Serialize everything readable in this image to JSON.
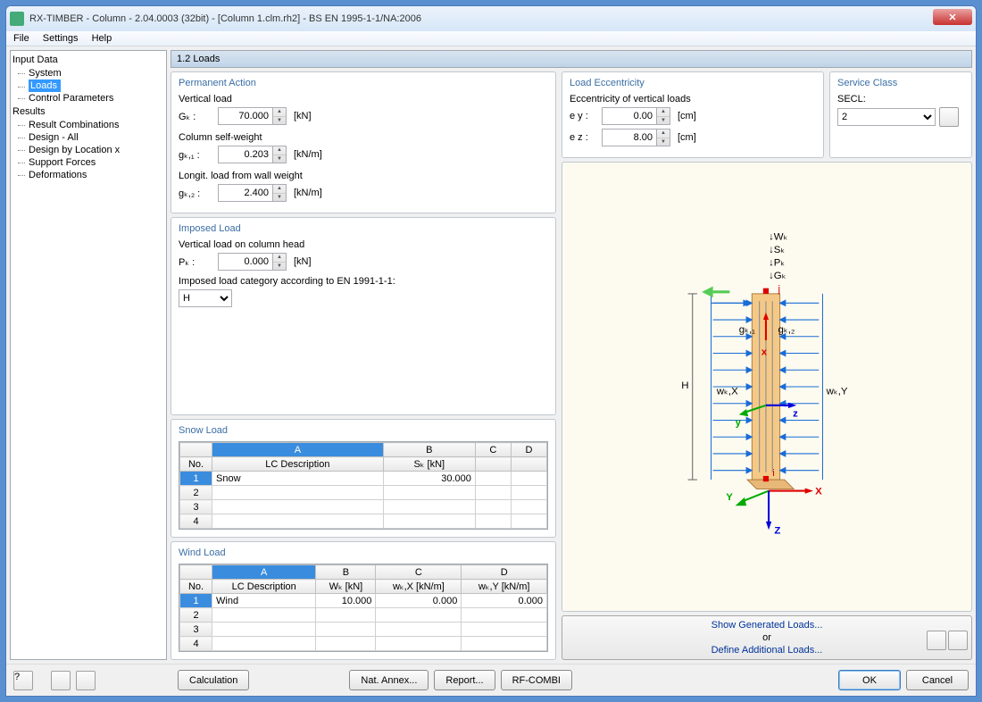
{
  "window_title": "RX-TIMBER - Column - 2.04.0003 (32bit) - [Column 1.clm.rh2] - BS EN 1995-1-1/NA:2006",
  "menu": {
    "file": "File",
    "settings": "Settings",
    "help": "Help"
  },
  "tree": {
    "input_data": "Input Data",
    "system": "System",
    "loads": "Loads",
    "control_params": "Control Parameters",
    "results": "Results",
    "result_comb": "Result Combinations",
    "design_all": "Design - All",
    "design_loc": "Design by Location x",
    "support_forces": "Support Forces",
    "deformations": "Deformations"
  },
  "header": "1.2 Loads",
  "permanent": {
    "legend": "Permanent Action",
    "vertical_load": "Vertical load",
    "gk_label": "Gₖ :",
    "gk_value": "70.000",
    "gk_unit": "[kN]",
    "self_weight": "Column self-weight",
    "gk1_label": "gₖ,₁ :",
    "gk1_value": "0.203",
    "gk1_unit": "[kN/m]",
    "longit": "Longit. load from wall weight",
    "gk2_label": "gₖ,₂ :",
    "gk2_value": "2.400",
    "gk2_unit": "[kN/m]"
  },
  "imposed": {
    "legend": "Imposed Load",
    "vert_head": "Vertical load on column head",
    "pk_label": "Pₖ :",
    "pk_value": "0.000",
    "pk_unit": "[kN]",
    "category_label": "Imposed load category according to EN 1991-1-1:",
    "category_value": "H"
  },
  "snow": {
    "legend": "Snow Load",
    "cols": {
      "no": "No.",
      "a": "A",
      "b": "B",
      "c": "C",
      "d": "D"
    },
    "hdr": {
      "lc": "LC Description",
      "sk": "Sₖ [kN]"
    },
    "row1": {
      "num": "1",
      "desc": "Snow",
      "sk": "30.000"
    },
    "row2": "2",
    "row3": "3",
    "row4": "4"
  },
  "wind": {
    "legend": "Wind Load",
    "cols": {
      "no": "No.",
      "a": "A",
      "b": "B",
      "c": "C",
      "d": "D"
    },
    "hdr": {
      "lc": "LC Description",
      "wk": "Wₖ [kN]",
      "wkx": "wₖ,X [kN/m]",
      "wky": "wₖ,Y [kN/m]"
    },
    "row1": {
      "num": "1",
      "desc": "Wind",
      "wk": "10.000",
      "wkx": "0.000",
      "wky": "0.000"
    },
    "row2": "2",
    "row3": "3",
    "row4": "4"
  },
  "ecc": {
    "legend": "Load Eccentricity",
    "heading": "Eccentricity of vertical loads",
    "ey_label": "e y :",
    "ey_value": "0.00",
    "ey_unit": "[cm]",
    "ez_label": "e z :",
    "ez_value": "8.00",
    "ez_unit": "[cm]"
  },
  "svc": {
    "legend": "Service Class",
    "secl": "SECL:",
    "value": "2"
  },
  "gen": {
    "show": "Show Generated Loads...",
    "or": "or",
    "define": "Define Additional Loads..."
  },
  "footer": {
    "calc": "Calculation",
    "nat": "Nat. Annex...",
    "report": "Report...",
    "rfcombi": "RF-COMBI",
    "ok": "OK",
    "cancel": "Cancel"
  }
}
